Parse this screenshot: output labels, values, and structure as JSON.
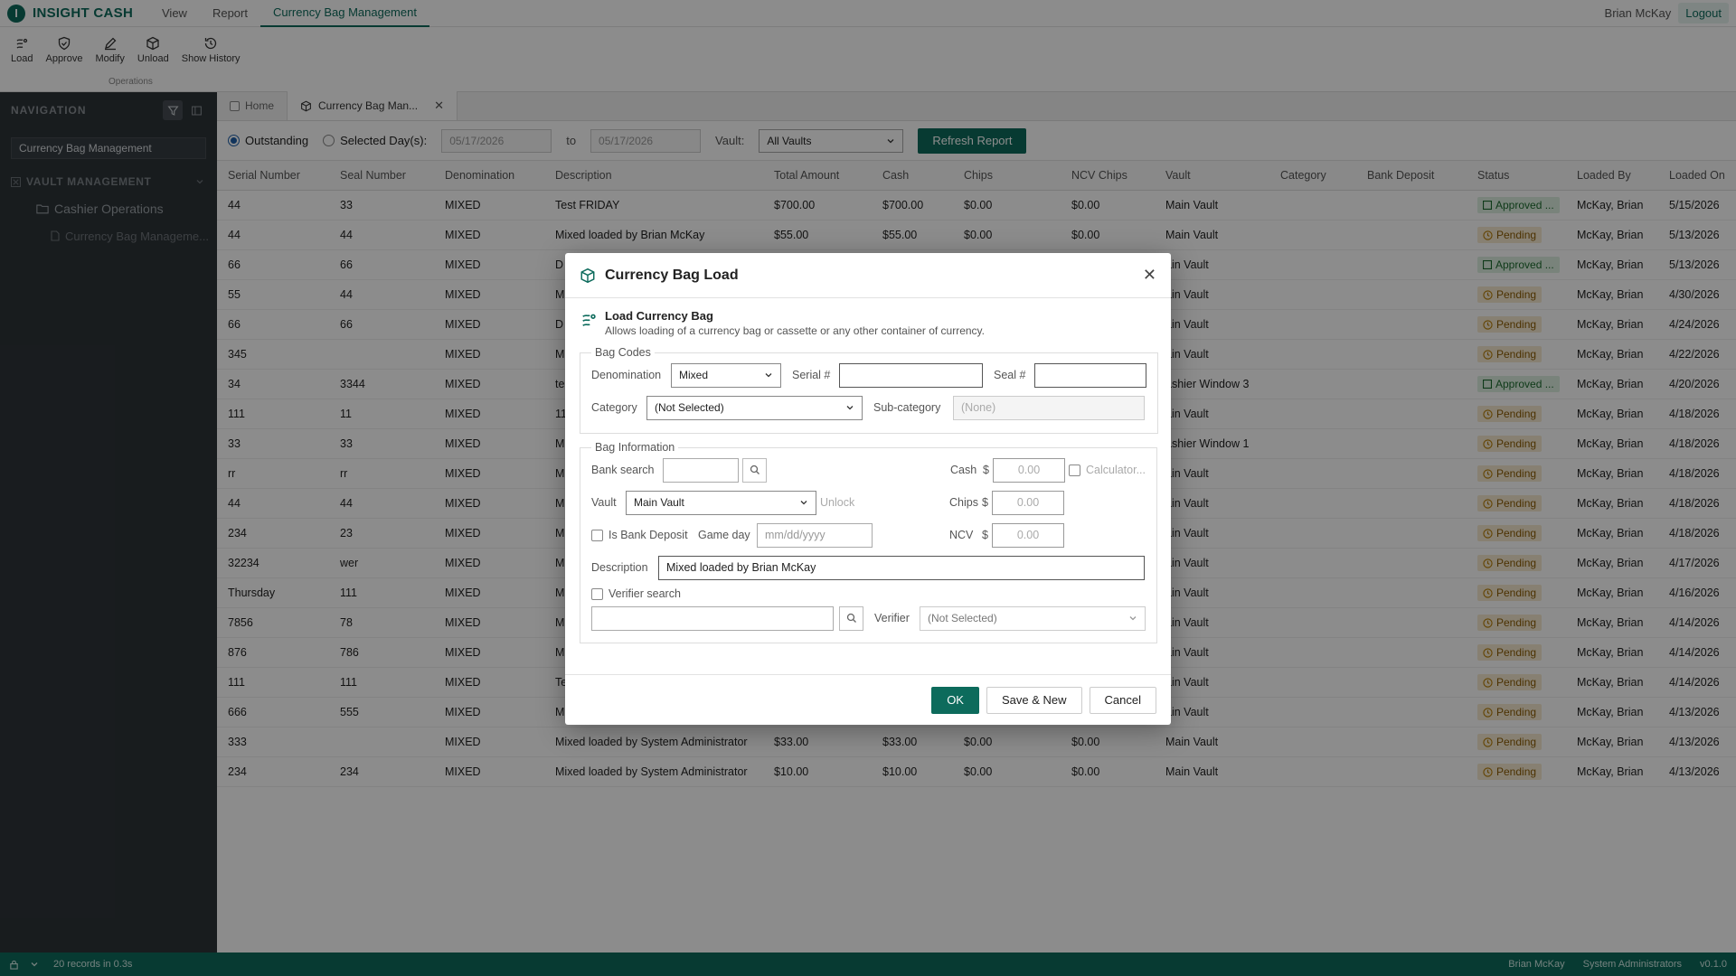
{
  "app": {
    "logo_letter": "I",
    "name": "INSIGHT CASH"
  },
  "menu": {
    "view": "View",
    "report": "Report",
    "active": "Currency Bag Management"
  },
  "user": {
    "name": "Brian McKay",
    "logout": "Logout"
  },
  "ribbon": {
    "buttons": [
      {
        "label": "Load",
        "icon": "load-icon"
      },
      {
        "label": "Approve",
        "icon": "shield-check-icon"
      },
      {
        "label": "Modify",
        "icon": "pencil-icon"
      },
      {
        "label": "Unload",
        "icon": "package-icon"
      },
      {
        "label": "Show History",
        "icon": "history-icon"
      }
    ],
    "group_label": "Operations"
  },
  "sidebar": {
    "title": "NAVIGATION",
    "search_value": "Currency Bag Management",
    "group": "VAULT MANAGEMENT",
    "folder": "Cashier Operations",
    "leaf": "Currency Bag Manageme..."
  },
  "tabs": {
    "home": "Home",
    "active": "Currency Bag Man..."
  },
  "filter": {
    "outstanding": "Outstanding",
    "selected_days": "Selected Day(s):",
    "date_from": "05/17/2026",
    "to": "to",
    "date_to": "05/17/2026",
    "vault_label": "Vault:",
    "vault_value": "All Vaults",
    "refresh": "Refresh Report"
  },
  "table": {
    "columns": [
      "Serial Number",
      "Seal Number",
      "Denomination",
      "Description",
      "Total Amount",
      "Cash",
      "Chips",
      "NCV Chips",
      "Vault",
      "Category",
      "Bank Deposit",
      "Status",
      "Loaded By",
      "Loaded On"
    ],
    "rows": [
      [
        "44",
        "33",
        "MIXED",
        "Test FRIDAY",
        "$700.00",
        "$700.00",
        "$0.00",
        "$0.00",
        "Main Vault",
        "",
        "",
        "Approved ...",
        "McKay, Brian",
        "5/15/2026"
      ],
      [
        "44",
        "44",
        "MIXED",
        "Mixed loaded by Brian McKay",
        "$55.00",
        "$55.00",
        "$0.00",
        "$0.00",
        "Main Vault",
        "",
        "",
        "Pending",
        "McKay, Brian",
        "5/13/2026"
      ],
      [
        "66",
        "66",
        "MIXED",
        "D",
        "",
        "",
        "",
        "",
        "ain Vault",
        "",
        "",
        "Approved ...",
        "McKay, Brian",
        "5/13/2026"
      ],
      [
        "55",
        "44",
        "MIXED",
        "M",
        "",
        "",
        "",
        "",
        "ain Vault",
        "",
        "",
        "Pending",
        "McKay, Brian",
        "4/30/2026"
      ],
      [
        "66",
        "66",
        "MIXED",
        "D",
        "",
        "",
        "",
        "",
        "ain Vault",
        "",
        "",
        "Pending",
        "McKay, Brian",
        "4/24/2026"
      ],
      [
        "345",
        "",
        "MIXED",
        "M",
        "",
        "",
        "",
        "",
        "ain Vault",
        "",
        "",
        "Pending",
        "McKay, Brian",
        "4/22/2026"
      ],
      [
        "34",
        "3344",
        "MIXED",
        "te",
        "",
        "",
        "",
        "",
        "ashier Window 3",
        "",
        "",
        "Approved ...",
        "McKay, Brian",
        "4/20/2026"
      ],
      [
        "111",
        "11",
        "MIXED",
        "11",
        "",
        "",
        "",
        "",
        "ain Vault",
        "",
        "",
        "Pending",
        "McKay, Brian",
        "4/18/2026"
      ],
      [
        "33",
        "33",
        "MIXED",
        "M",
        "",
        "",
        "",
        "",
        "ashier Window 1",
        "",
        "",
        "Pending",
        "McKay, Brian",
        "4/18/2026"
      ],
      [
        "rr",
        "rr",
        "MIXED",
        "M",
        "",
        "",
        "",
        "",
        "ain Vault",
        "",
        "",
        "Pending",
        "McKay, Brian",
        "4/18/2026"
      ],
      [
        "44",
        "44",
        "MIXED",
        "M",
        "",
        "",
        "",
        "",
        "ain Vault",
        "",
        "",
        "Pending",
        "McKay, Brian",
        "4/18/2026"
      ],
      [
        "234",
        "23",
        "MIXED",
        "M",
        "",
        "",
        "",
        "",
        "ain Vault",
        "",
        "",
        "Pending",
        "McKay, Brian",
        "4/18/2026"
      ],
      [
        "32234",
        "wer",
        "MIXED",
        "M",
        "",
        "",
        "",
        "",
        "ain Vault",
        "",
        "",
        "Pending",
        "McKay, Brian",
        "4/17/2026"
      ],
      [
        "Thursday",
        "111",
        "MIXED",
        "M",
        "",
        "",
        "",
        "",
        "ain Vault",
        "",
        "",
        "Pending",
        "McKay, Brian",
        "4/16/2026"
      ],
      [
        "7856",
        "78",
        "MIXED",
        "M",
        "",
        "",
        "",
        "",
        "ain Vault",
        "",
        "",
        "Pending",
        "McKay, Brian",
        "4/14/2026"
      ],
      [
        "876",
        "786",
        "MIXED",
        "M",
        "",
        "",
        "",
        "",
        "ain Vault",
        "",
        "",
        "Pending",
        "McKay, Brian",
        "4/14/2026"
      ],
      [
        "111",
        "111",
        "MIXED",
        "Te",
        "",
        "",
        "",
        "",
        "ain Vault",
        "",
        "",
        "Pending",
        "McKay, Brian",
        "4/14/2026"
      ],
      [
        "666",
        "555",
        "MIXED",
        "M",
        "",
        "",
        "",
        "",
        "ain Vault",
        "",
        "",
        "Pending",
        "McKay, Brian",
        "4/13/2026"
      ],
      [
        "333",
        "",
        "MIXED",
        "Mixed loaded by System Administrator",
        "$33.00",
        "$33.00",
        "$0.00",
        "$0.00",
        "Main Vault",
        "",
        "",
        "Pending",
        "McKay, Brian",
        "4/13/2026"
      ],
      [
        "234",
        "234",
        "MIXED",
        "Mixed loaded by System Administrator",
        "$10.00",
        "$10.00",
        "$0.00",
        "$0.00",
        "Main Vault",
        "",
        "",
        "Pending",
        "McKay, Brian",
        "4/13/2026"
      ]
    ]
  },
  "statusbar": {
    "records": "20 records in 0.3s",
    "user": "Brian McKay",
    "role": "System Administrators",
    "version": "v0.1.0"
  },
  "modal": {
    "title": "Currency Bag Load",
    "intro_title": "Load Currency Bag",
    "intro_desc": "Allows loading of a currency bag or cassette or any other container of currency.",
    "bag_codes": {
      "legend": "Bag Codes",
      "denomination_label": "Denomination",
      "denomination_value": "Mixed",
      "serial_label": "Serial #",
      "serial_value": "",
      "seal_label": "Seal #",
      "seal_value": "",
      "category_label": "Category",
      "category_value": "(Not Selected)",
      "subcategory_label": "Sub-category",
      "subcategory_placeholder": "(None)"
    },
    "bag_info": {
      "legend": "Bag Information",
      "bank_search_label": "Bank search",
      "vault_label": "Vault",
      "vault_value": "Main Vault",
      "unlock": "Unlock",
      "is_bank_deposit": "Is Bank Deposit",
      "game_day_label": "Game day",
      "game_day_placeholder": "mm/dd/yyyy",
      "cash_label": "Cash",
      "chips_label": "Chips",
      "ncv_label": "NCV",
      "currency": "$",
      "cash_value": "0.00",
      "chips_value": "0.00",
      "ncv_value": "0.00",
      "calculator": "Calculator...",
      "description_label": "Description",
      "description_value": "Mixed loaded by Brian McKay",
      "verifier_search": "Verifier search",
      "verifier_label": "Verifier",
      "verifier_value": "(Not Selected)"
    },
    "buttons": {
      "ok": "OK",
      "save_new": "Save & New",
      "cancel": "Cancel"
    }
  },
  "colors": {
    "brand": "#0d6b5c",
    "pending_bg": "#f6ead0",
    "approved_bg": "#dcefe0"
  }
}
